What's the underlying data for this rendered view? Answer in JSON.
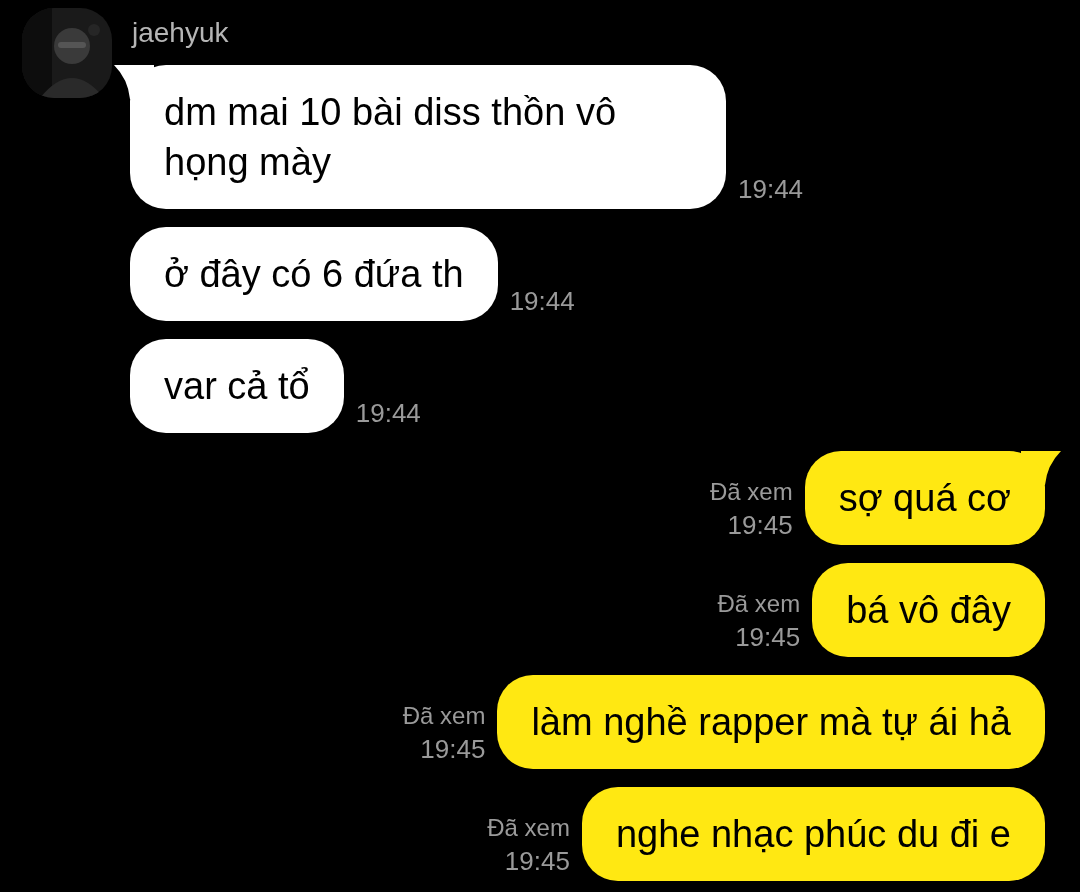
{
  "contact": {
    "name": "jaehyuk"
  },
  "messages": [
    {
      "kind": "incoming",
      "tail": true,
      "text": "dm mai 10 bài diss thồn vô họng mày",
      "time": "19:44"
    },
    {
      "kind": "incoming",
      "tail": false,
      "text": "ở đây có 6 đứa th",
      "time": "19:44"
    },
    {
      "kind": "incoming",
      "tail": false,
      "text": "var cả tổ",
      "time": "19:44"
    },
    {
      "kind": "outgoing",
      "tail": true,
      "text": "sợ quá cơ",
      "status": "Đã xem",
      "time": "19:45"
    },
    {
      "kind": "outgoing",
      "tail": false,
      "text": "bá vô đây",
      "status": "Đã xem",
      "time": "19:45"
    },
    {
      "kind": "outgoing",
      "tail": false,
      "text": "làm nghề rapper mà tự ái hả",
      "status": "Đã xem",
      "time": "19:45"
    },
    {
      "kind": "outgoing",
      "tail": false,
      "text": "nghe nhạc phúc du đi e",
      "status": "Đã xem",
      "time": "19:45"
    }
  ]
}
